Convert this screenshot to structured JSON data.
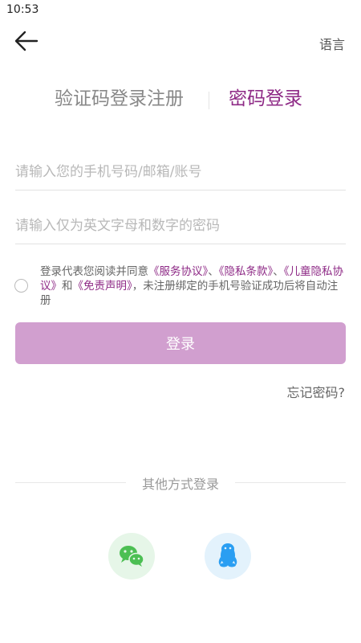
{
  "status_bar": {
    "time": "10:53"
  },
  "header": {
    "language_label": "语言"
  },
  "tabs": [
    {
      "label": "验证码登录注册"
    },
    {
      "label": "密码登录"
    }
  ],
  "form": {
    "account_placeholder": "请输入您的手机号码/邮箱/账号",
    "password_placeholder": "请输入仅为英文字母和数字的密码",
    "agreement": {
      "text_before": "登录代表您阅读并同意",
      "link_service": "《服务协议》",
      "sep1": "、",
      "link_privacy": "《隐私条款》",
      "sep2": "、",
      "link_child_privacy": "《儿童隐私协议》",
      "text_and": "和",
      "link_disclaimer": "《免责声明》",
      "text_after": "，未注册绑定的手机号验证成功后将自动注册"
    },
    "login_label": "登录",
    "forgot_password": "忘记密码?"
  },
  "other_login": {
    "label": "其他方式登录",
    "options": [
      {
        "icon": "wechat-icon",
        "color": "#4cbf53"
      },
      {
        "icon": "qq-icon",
        "color": "#2a9ef2"
      }
    ]
  },
  "colors": {
    "accent": "#8e2a86",
    "login_button": "#d19fcf"
  }
}
